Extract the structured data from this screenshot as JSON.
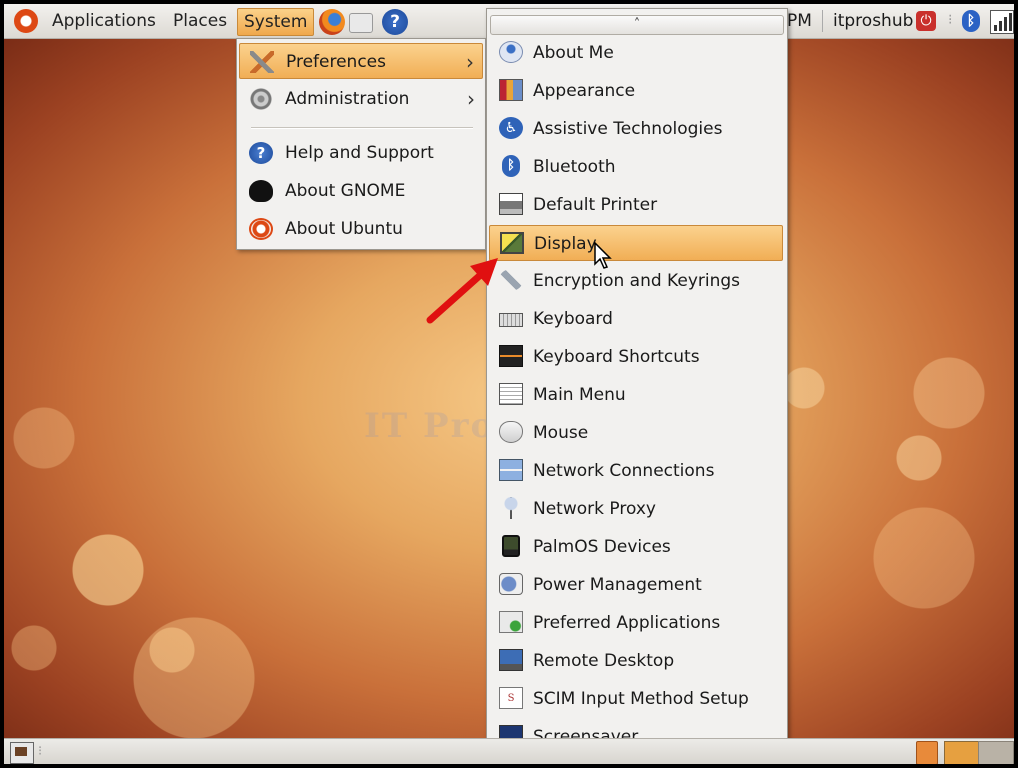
{
  "top_panel": {
    "applications_label": "Applications",
    "places_label": "Places",
    "system_label": "System",
    "clock_fragment": "PM",
    "username": "itproshub",
    "launchers": [
      "firefox-icon",
      "mail-icon",
      "help-icon"
    ]
  },
  "system_menu": {
    "items": [
      {
        "label": "Preferences",
        "icon": "preferences-icon",
        "submenu": true,
        "highlighted": true
      },
      {
        "label": "Administration",
        "icon": "administration-icon",
        "submenu": true
      },
      {
        "label": "Help and Support",
        "icon": "help-icon"
      },
      {
        "label": "About GNOME",
        "icon": "gnome-foot-icon"
      },
      {
        "label": "About Ubuntu",
        "icon": "ubuntu-icon"
      }
    ]
  },
  "preferences_menu": {
    "scroll_up": "˄",
    "scroll_down": "˅",
    "items": [
      {
        "label": "About Me",
        "icon": "about-me-icon"
      },
      {
        "label": "Appearance",
        "icon": "appearance-icon"
      },
      {
        "label": "Assistive Technologies",
        "icon": "accessibility-icon"
      },
      {
        "label": "Bluetooth",
        "icon": "bluetooth-icon"
      },
      {
        "label": "Default Printer",
        "icon": "printer-icon"
      },
      {
        "label": "Display",
        "icon": "display-icon",
        "highlighted": true
      },
      {
        "label": "Encryption and Keyrings",
        "icon": "keyring-icon"
      },
      {
        "label": "Keyboard",
        "icon": "keyboard-icon"
      },
      {
        "label": "Keyboard Shortcuts",
        "icon": "keyboard-shortcuts-icon"
      },
      {
        "label": "Main Menu",
        "icon": "main-menu-icon"
      },
      {
        "label": "Mouse",
        "icon": "mouse-icon"
      },
      {
        "label": "Network Connections",
        "icon": "network-connections-icon"
      },
      {
        "label": "Network Proxy",
        "icon": "network-proxy-icon"
      },
      {
        "label": "PalmOS Devices",
        "icon": "palm-device-icon"
      },
      {
        "label": "Power Management",
        "icon": "power-management-icon"
      },
      {
        "label": "Preferred Applications",
        "icon": "preferred-apps-icon"
      },
      {
        "label": "Remote Desktop",
        "icon": "remote-desktop-icon"
      },
      {
        "label": "SCIM Input Method Setup",
        "icon": "scim-icon"
      },
      {
        "label": "Screensaver",
        "icon": "screensaver-icon"
      }
    ]
  },
  "desktop": {
    "watermark": "IT ProHUB"
  },
  "colors": {
    "highlight": "#f1ae55",
    "ubuntu_orange": "#dd4814",
    "annotation_arrow": "#e01010"
  }
}
